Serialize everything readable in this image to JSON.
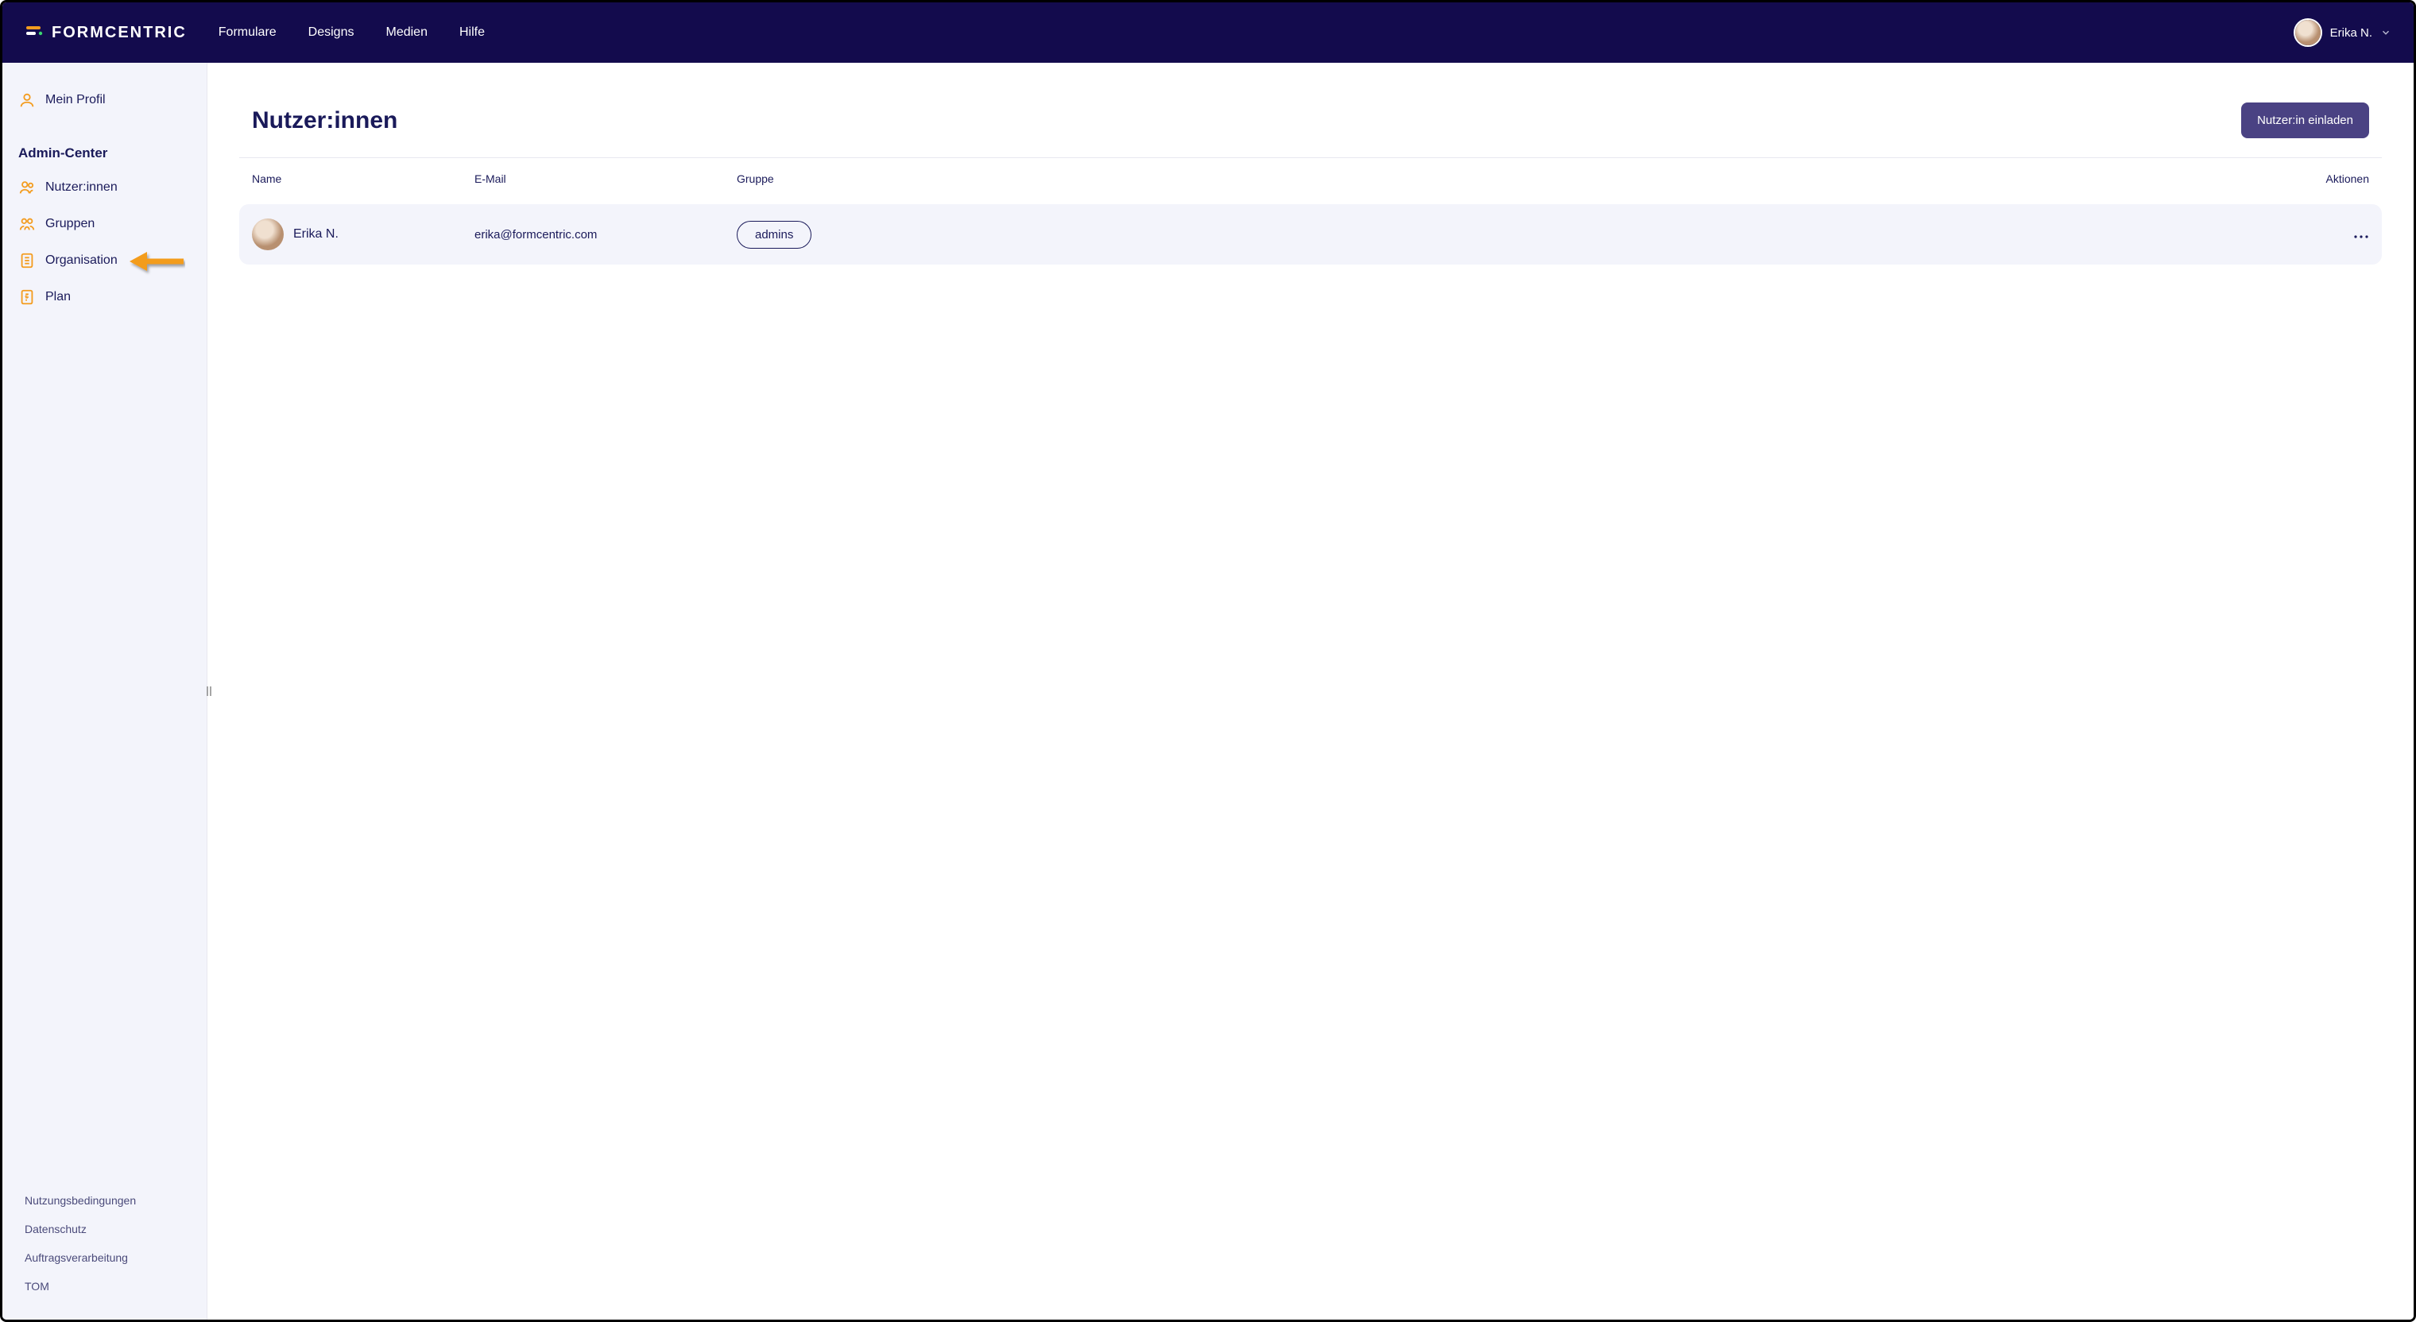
{
  "brand": "FORMCENTRIC",
  "nav": {
    "items": [
      "Formulare",
      "Designs",
      "Medien",
      "Hilfe"
    ]
  },
  "user": {
    "name": "Erika N."
  },
  "sidebar": {
    "profile_label": "Mein Profil",
    "heading": "Admin-Center",
    "items": [
      {
        "label": "Nutzer:innen"
      },
      {
        "label": "Gruppen"
      },
      {
        "label": "Organisation"
      },
      {
        "label": "Plan"
      }
    ],
    "footer": [
      "Nutzungsbedingungen",
      "Datenschutz",
      "Auftragsverarbeitung",
      "TOM"
    ]
  },
  "main": {
    "title": "Nutzer:innen",
    "invite_button": "Nutzer:in einladen",
    "columns": {
      "name": "Name",
      "email": "E-Mail",
      "group": "Gruppe",
      "actions": "Aktionen"
    },
    "rows": [
      {
        "name": "Erika N.",
        "email": "erika@formcentric.com",
        "group": "admins"
      }
    ]
  },
  "colors": {
    "header_bg": "#130B4D",
    "accent_orange": "#F39C1F",
    "button_bg": "#4A4283",
    "text_primary": "#1a1a5a",
    "sidebar_bg": "#F3F4FB"
  }
}
